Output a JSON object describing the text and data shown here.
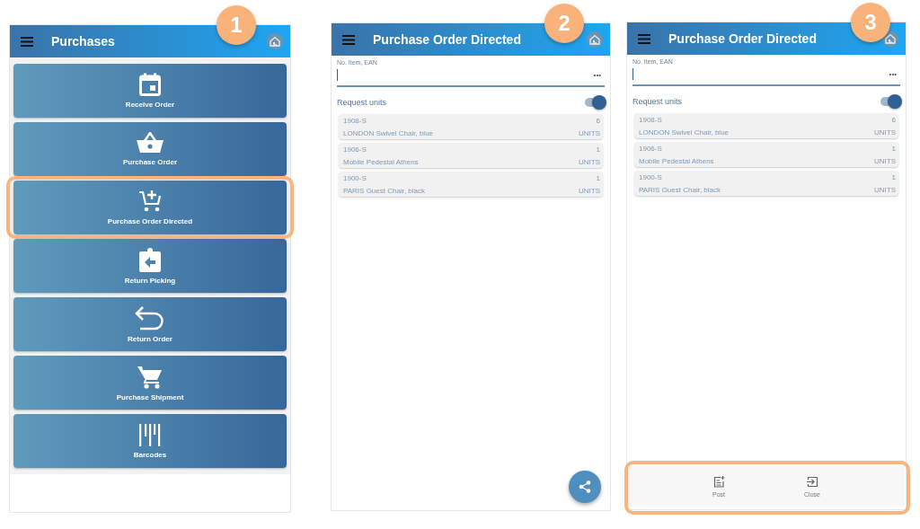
{
  "screens": [
    {
      "kind": "menu",
      "number": "1",
      "title": "Purchases",
      "tiles": [
        {
          "label": "Receive Order",
          "highlighted": false
        },
        {
          "label": "Purchase Order",
          "highlighted": false
        },
        {
          "label": "Purchase Order Directed",
          "highlighted": true
        },
        {
          "label": "Return Picking",
          "highlighted": false
        },
        {
          "label": "Return Order",
          "highlighted": false
        },
        {
          "label": "Purchase Shipment",
          "highlighted": false
        },
        {
          "label": "Barcodes",
          "highlighted": false
        }
      ]
    },
    {
      "kind": "list",
      "number": "2",
      "title": "Purchase Order Directed",
      "field_label": "No. Item, EAN",
      "more_button": "•••",
      "toggle_label": "Request units",
      "toggle_on": true,
      "items": [
        {
          "code": "1908-S",
          "name": "LONDON Swivel Chair, blue",
          "qty": "6",
          "unit": "UNITS"
        },
        {
          "code": "1906-S",
          "name": "Mobile Pedestal Athens",
          "qty": "1",
          "unit": "UNITS"
        },
        {
          "code": "1900-S",
          "name": "PARIS Guest Chair, black",
          "qty": "1",
          "unit": "UNITS"
        }
      ]
    },
    {
      "kind": "list",
      "number": "3",
      "title": "Purchase Order Directed",
      "field_label": "No. Item, EAN",
      "more_button": "•••",
      "toggle_label": "Request units",
      "toggle_on": true,
      "actions_highlighted": true,
      "actions": [
        {
          "label": "Post"
        },
        {
          "label": "Close"
        }
      ],
      "items": [
        {
          "code": "1908-S",
          "name": "LONDON Swivel Chair, blue",
          "qty": "6",
          "unit": "UNITS"
        },
        {
          "code": "1906-S",
          "name": "Mobile Pedestal Athens",
          "qty": "1",
          "unit": "UNITS"
        },
        {
          "code": "1900-S",
          "name": "PARIS Guest Chair, black",
          "qty": "1",
          "unit": "UNITS"
        }
      ]
    }
  ]
}
